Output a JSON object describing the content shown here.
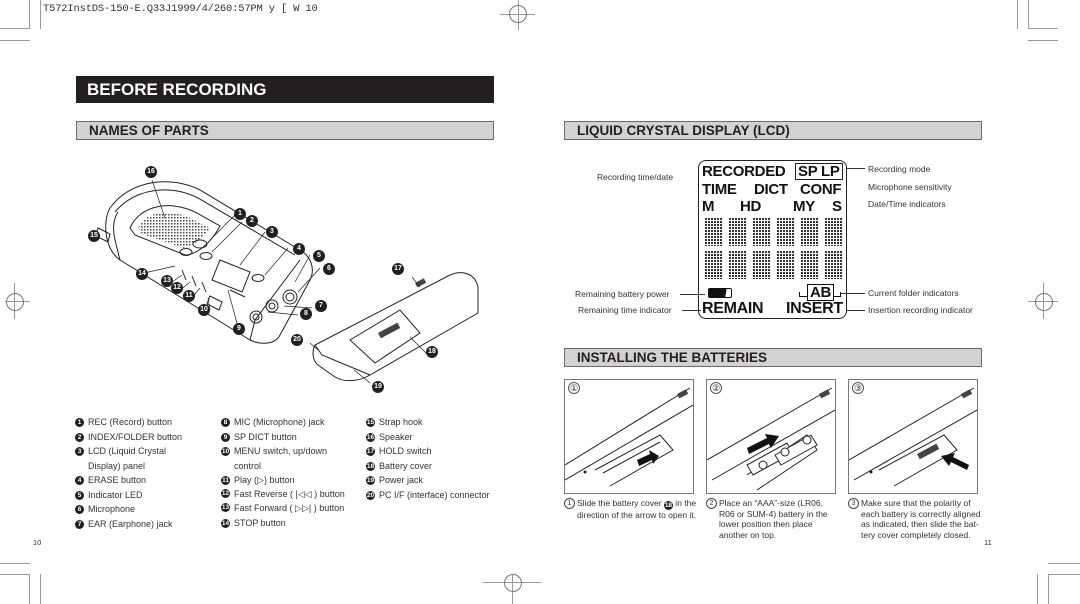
{
  "slug": "T572InstDS-150-E.Q33J1999/4/260:57PM y [ W 10",
  "page": {
    "title": "BEFORE RECORDING",
    "left_page_number": "10",
    "right_page_number": "11"
  },
  "names_of_parts": {
    "heading": "NAMES OF PARTS",
    "parts": [
      {
        "num": "1",
        "label": "REC (Record) button"
      },
      {
        "num": "2",
        "label": "INDEX/FOLDER button"
      },
      {
        "num": "3",
        "label": "LCD (Liquid Crystal",
        "cont": "Display) panel"
      },
      {
        "num": "4",
        "label": "ERASE button"
      },
      {
        "num": "5",
        "label": "Indicator LED"
      },
      {
        "num": "6",
        "label": "Microphone"
      },
      {
        "num": "7",
        "label": "EAR (Earphone) jack"
      },
      {
        "num": "8",
        "label": "MIC (Microphone) jack"
      },
      {
        "num": "9",
        "label": "SP DICT button"
      },
      {
        "num": "10",
        "label": "MENU switch, up/down",
        "cont": "control"
      },
      {
        "num": "11",
        "label": "Play (",
        "icon": "▷",
        "after": ") button"
      },
      {
        "num": "12",
        "label": "Fast Reverse (",
        "icon": "|◁◁",
        "after": ") button"
      },
      {
        "num": "13",
        "label": "Fast Forward (",
        "icon": "▷▷|",
        "after": ") button"
      },
      {
        "num": "14",
        "label": "STOP button"
      },
      {
        "num": "15",
        "label": "Strap hook"
      },
      {
        "num": "16",
        "label": "Speaker"
      },
      {
        "num": "17",
        "label": "HOLD switch"
      },
      {
        "num": "18",
        "label": "Battery cover"
      },
      {
        "num": "19",
        "label": "Power jack"
      },
      {
        "num": "20",
        "label": "PC I/F (interface) connector"
      }
    ]
  },
  "lcd": {
    "heading": "LIQUID CRYSTAL DISPLAY (LCD)",
    "display": {
      "row1_left": "RECORDED",
      "row1_box": "SP LP",
      "row2": [
        "TIME",
        "DICT",
        "CONF"
      ],
      "row3": [
        "M",
        "HD",
        "MY",
        "S"
      ],
      "folder_box": "AB",
      "remain": "REMAIN",
      "insert": "INSERT"
    },
    "labels_left": {
      "recording_time_date": "Recording time/date",
      "remaining_battery": "Remaining battery power",
      "remaining_time": "Remaining time indicator"
    },
    "labels_right": {
      "recording_mode": "Recording mode",
      "mic_sensitivity": "Microphone sensitivity",
      "date_time": "Date/Time indicators",
      "current_folder": "Current folder indicators",
      "insertion": "Insertion recording indicator"
    }
  },
  "batteries": {
    "heading": "INSTALLING THE BATTERIES",
    "steps": [
      {
        "num": "①",
        "text_a": "Slide the battery cover ",
        "ref": "18",
        "text_b": " in the direction of the arrow to open it."
      },
      {
        "num": "②",
        "text_a": "Place an “AAA”-size (LR06, R06 or SUM-4) battery in the lower position then place another on top."
      },
      {
        "num": "③",
        "text_a": "Make sure that the polarity of each battery is correctly aligned as indicated, then slide the bat-tery cover completely closed."
      }
    ]
  }
}
